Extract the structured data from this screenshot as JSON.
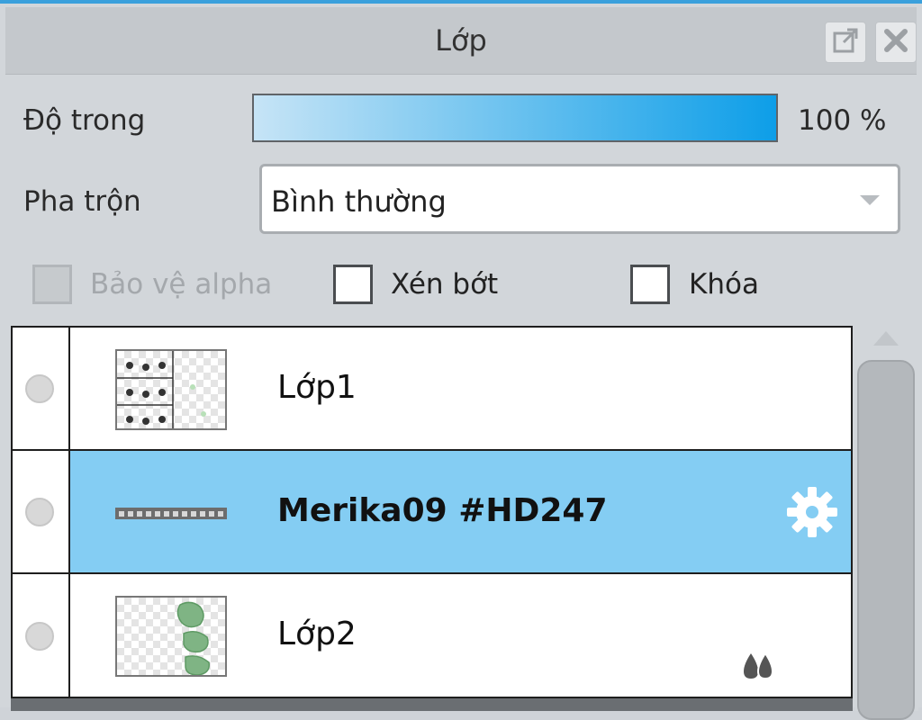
{
  "panel": {
    "title": "Lớp",
    "accent_color": "#3aa0dc",
    "buttons": {
      "popout_icon": "popout-icon",
      "close_icon": "close-icon"
    }
  },
  "opacity": {
    "label": "Độ trong",
    "value": 100,
    "value_text": "100 %"
  },
  "blend": {
    "label": "Pha trộn",
    "value": "Bình thường"
  },
  "checkboxes": {
    "protect_alpha": {
      "label": "Bảo vệ alpha",
      "checked": false,
      "disabled": true
    },
    "clipping": {
      "label": "Xén bớt",
      "checked": false
    },
    "lock": {
      "label": "Khóa",
      "checked": false
    }
  },
  "layers": [
    {
      "name": "Lớp1",
      "selected": false,
      "visible": true
    },
    {
      "name": "Merika09 #HD247",
      "selected": true,
      "visible": true,
      "badge_icon": "gear-icon"
    },
    {
      "name": "Lớp2",
      "selected": false,
      "visible": true,
      "badge_icon": "clipping-icon"
    }
  ],
  "colors": {
    "selected_row": "#84cdf3",
    "opacity_start": "#c6e4f6",
    "opacity_end": "#0d9ee8"
  }
}
